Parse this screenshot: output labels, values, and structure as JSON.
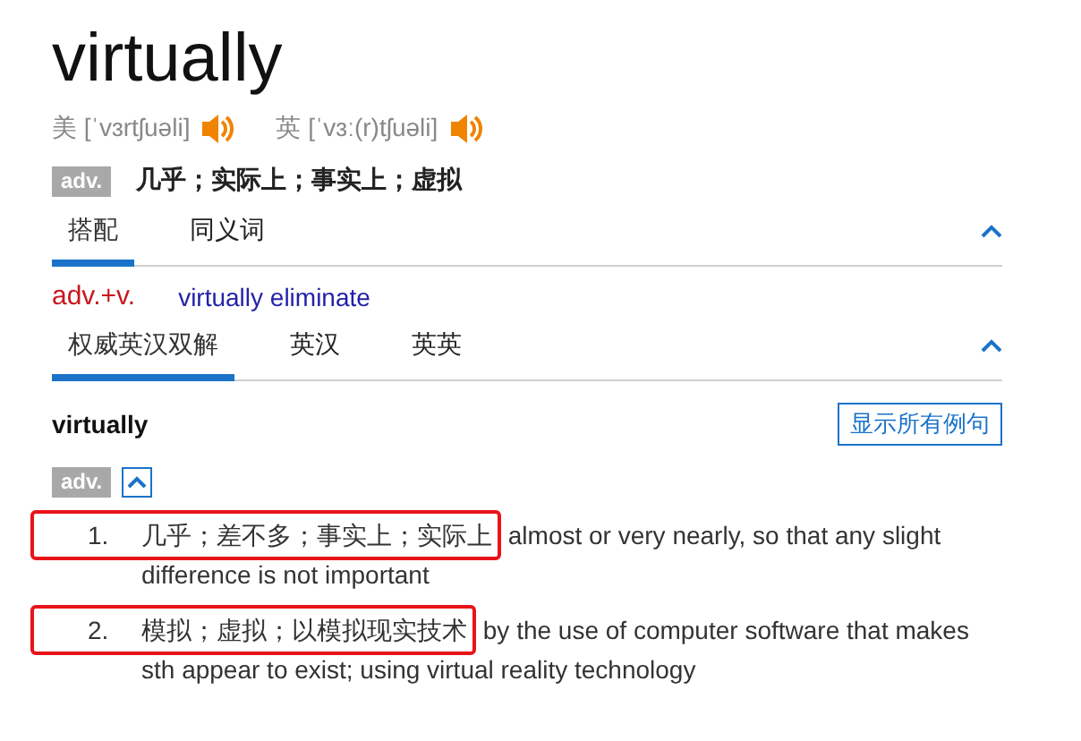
{
  "headword": "virtually",
  "pronunciations": [
    {
      "region": "美",
      "phonetic": "[ˈvɜrtʃuəli]"
    },
    {
      "region": "英",
      "phonetic": "[ˈvɜː(r)tʃuəli]"
    }
  ],
  "summary": {
    "pos": "adv.",
    "meaning": "几乎；实际上；事实上；虚拟"
  },
  "phrase_section": {
    "tabs": [
      {
        "label": "搭配",
        "selected": true
      },
      {
        "label": "同义词",
        "selected": false
      }
    ],
    "expanded": true,
    "collocation": {
      "pattern": "adv.+v.",
      "example": "virtually eliminate"
    }
  },
  "dict_section": {
    "tabs": [
      {
        "label": "权威英汉双解",
        "selected": true
      },
      {
        "label": "英汉",
        "selected": false
      },
      {
        "label": "英英",
        "selected": false
      }
    ],
    "expanded": true,
    "word": "virtually",
    "show_examples_button": "显示所有例句",
    "pos": "adv.",
    "pos_expanded": true,
    "definitions": [
      {
        "number": "1.",
        "zh": "几乎；差不多；事实上；实际上",
        "en": "almost or very nearly, so that any slight difference is not important",
        "highlighted": true
      },
      {
        "number": "2.",
        "zh": "模拟；虚拟；以模拟现实技术",
        "en": "by the use of computer software that makes sth appear to exist; using virtual reality technology",
        "highlighted": true
      }
    ]
  }
}
